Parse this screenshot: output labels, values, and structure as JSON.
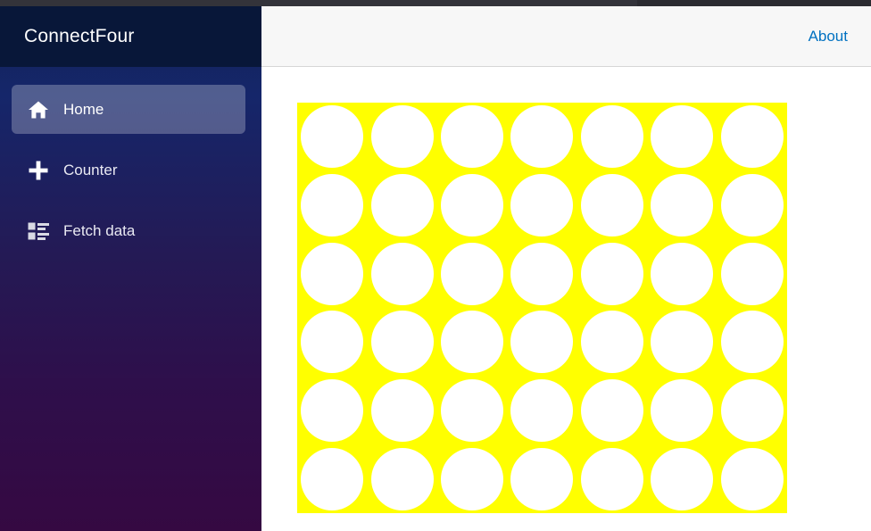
{
  "window": {
    "chrome_strip": true
  },
  "sidebar": {
    "brand": "ConnectFour",
    "items": [
      {
        "label": "Home",
        "icon": "home-icon",
        "active": true
      },
      {
        "label": "Counter",
        "icon": "plus-icon",
        "active": false
      },
      {
        "label": "Fetch data",
        "icon": "list-rich-icon",
        "active": false
      }
    ]
  },
  "topbar": {
    "about_label": "About"
  },
  "board": {
    "columns": 7,
    "rows": 6,
    "board_color": "#ffff00",
    "empty_cell_color": "#ffffff",
    "cells": [
      [
        "empty",
        "empty",
        "empty",
        "empty",
        "empty",
        "empty",
        "empty"
      ],
      [
        "empty",
        "empty",
        "empty",
        "empty",
        "empty",
        "empty",
        "empty"
      ],
      [
        "empty",
        "empty",
        "empty",
        "empty",
        "empty",
        "empty",
        "empty"
      ],
      [
        "empty",
        "empty",
        "empty",
        "empty",
        "empty",
        "empty",
        "empty"
      ],
      [
        "empty",
        "empty",
        "empty",
        "empty",
        "empty",
        "empty",
        "empty"
      ],
      [
        "empty",
        "empty",
        "empty",
        "empty",
        "empty",
        "empty",
        "empty"
      ]
    ]
  },
  "colors": {
    "brand_bar": "#081739",
    "sidebar_gradient_top": "#132356",
    "sidebar_gradient_bottom": "#350942",
    "link_blue": "#0071c1",
    "topbar_bg": "#f7f7f7",
    "yellow": "#ffff00"
  }
}
